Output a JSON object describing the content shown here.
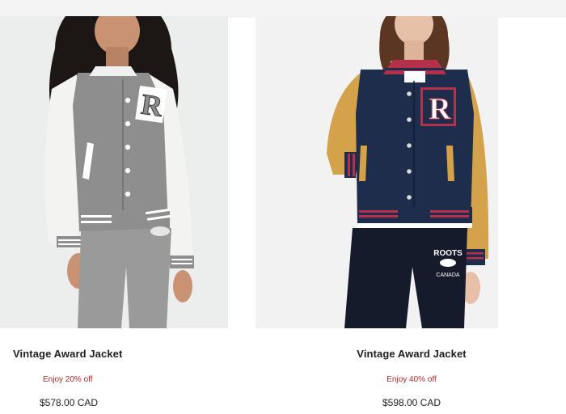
{
  "products": [
    {
      "title": "Vintage Award Jacket",
      "promo": "Enjoy 20% off",
      "price": "$578.00 CAD",
      "colors": {
        "body": "#8e8e8e",
        "sleeve": "#f3f3f1",
        "stripe": "#ffffff",
        "pants": "#9a9a9a",
        "hair": "#1c1714",
        "skin": "#c89273"
      },
      "patch_letter": "R"
    },
    {
      "title": "Vintage Award Jacket",
      "promo": "Enjoy 40% off",
      "price": "$598.00 CAD",
      "colors": {
        "body": "#1f2d4c",
        "sleeve": "#d3a24b",
        "stripe": "#b5304a",
        "pants": "#151b2b",
        "hair": "#5a3623",
        "skin": "#e6c0a8"
      },
      "patch_letter": "R",
      "pants_text": [
        "ROOTS",
        "CANADA"
      ]
    }
  ]
}
